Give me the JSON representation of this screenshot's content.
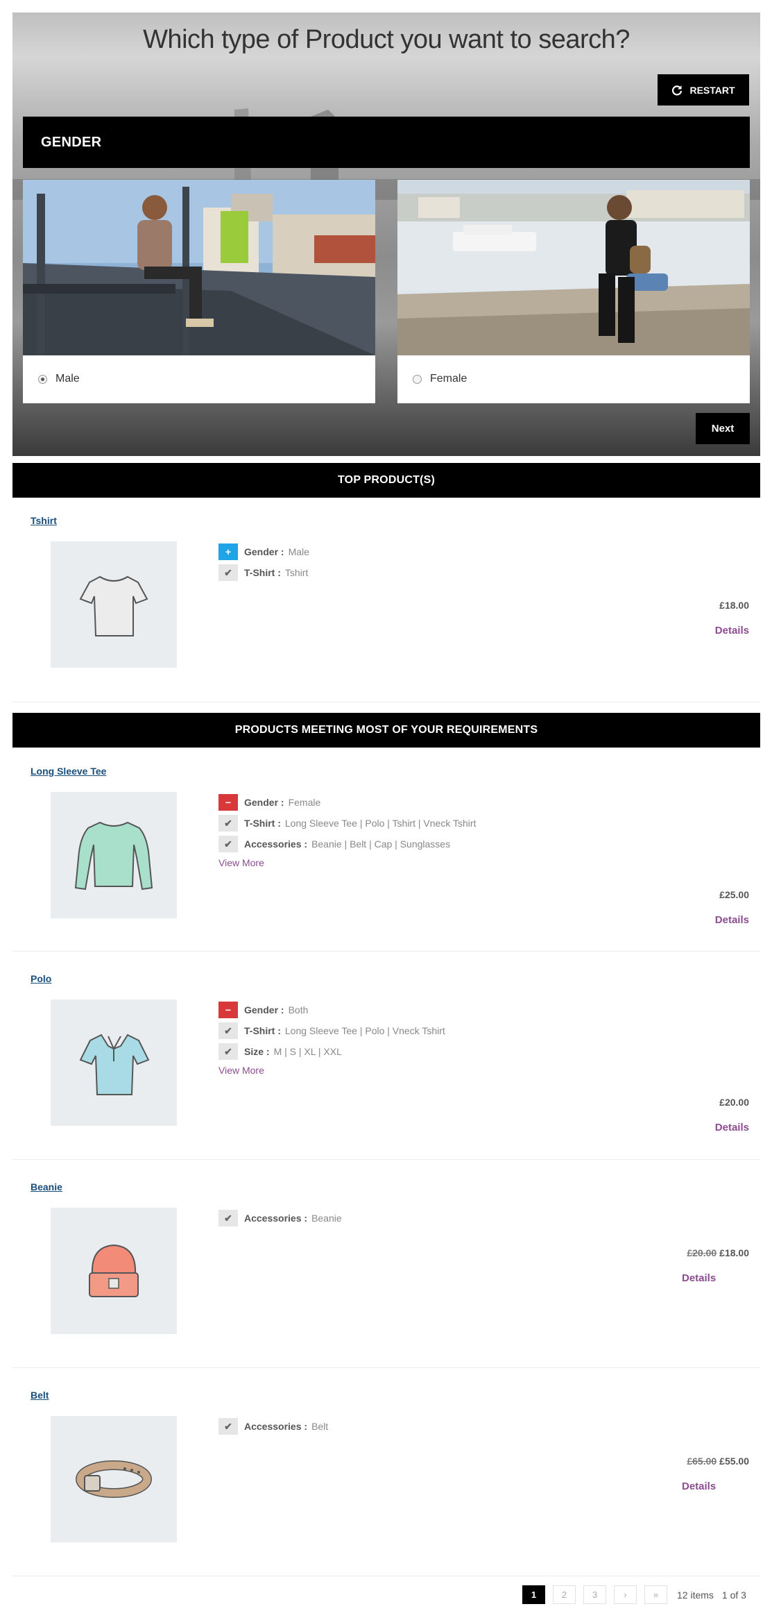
{
  "wizard": {
    "title": "Which type of Product you want to search?",
    "restart_label": "RESTART",
    "step_title": "GENDER",
    "options": [
      {
        "label": "Male",
        "selected": true
      },
      {
        "label": "Female",
        "selected": false
      }
    ],
    "next_label": "Next"
  },
  "top_section": {
    "title": "TOP PRODUCT(S)"
  },
  "matching_section": {
    "title": "PRODUCTS MEETING MOST OF YOUR REQUIREMENTS"
  },
  "products": [
    {
      "name": "Tshirt",
      "attributes": [
        {
          "status": "plus",
          "label": "Gender :",
          "value": "Male"
        },
        {
          "status": "check",
          "label": "T-Shirt :",
          "value": "Tshirt"
        }
      ],
      "price": "£18.00",
      "details_label": "Details"
    },
    {
      "name": "Long Sleeve Tee",
      "attributes": [
        {
          "status": "minus",
          "label": "Gender :",
          "value": "Female"
        },
        {
          "status": "check",
          "label": "T-Shirt :",
          "value": "Long Sleeve Tee | Polo | Tshirt | Vneck Tshirt"
        },
        {
          "status": "check",
          "label": "Accessories :",
          "value": "Beanie | Belt | Cap | Sunglasses"
        }
      ],
      "view_more_label": "View More",
      "price": "£25.00",
      "details_label": "Details"
    },
    {
      "name": "Polo",
      "attributes": [
        {
          "status": "minus",
          "label": "Gender :",
          "value": "Both"
        },
        {
          "status": "check",
          "label": "T-Shirt :",
          "value": "Long Sleeve Tee | Polo | Vneck Tshirt"
        },
        {
          "status": "check",
          "label": "Size :",
          "value": "M | S | XL | XXL"
        }
      ],
      "view_more_label": "View More",
      "price": "£20.00",
      "details_label": "Details"
    },
    {
      "name": "Beanie",
      "attributes": [
        {
          "status": "check",
          "label": "Accessories :",
          "value": "Beanie"
        }
      ],
      "old_price": "£20.00",
      "price": "£18.00",
      "details_label": "Details"
    },
    {
      "name": "Belt",
      "attributes": [
        {
          "status": "check",
          "label": "Accessories :",
          "value": "Belt"
        }
      ],
      "old_price": "£65.00",
      "price": "£55.00",
      "details_label": "Details"
    }
  ],
  "pagination": {
    "pages": [
      "1",
      "2",
      "3"
    ],
    "current_page": "1",
    "next_label": "›",
    "last_label": "»",
    "items_label": "12 items",
    "page_of_label": "1 of 3"
  },
  "colors": {
    "plus": "#1fa4e8",
    "minus": "#d9383a",
    "link": "#1a4e7a",
    "accent": "#8b4d8f"
  }
}
